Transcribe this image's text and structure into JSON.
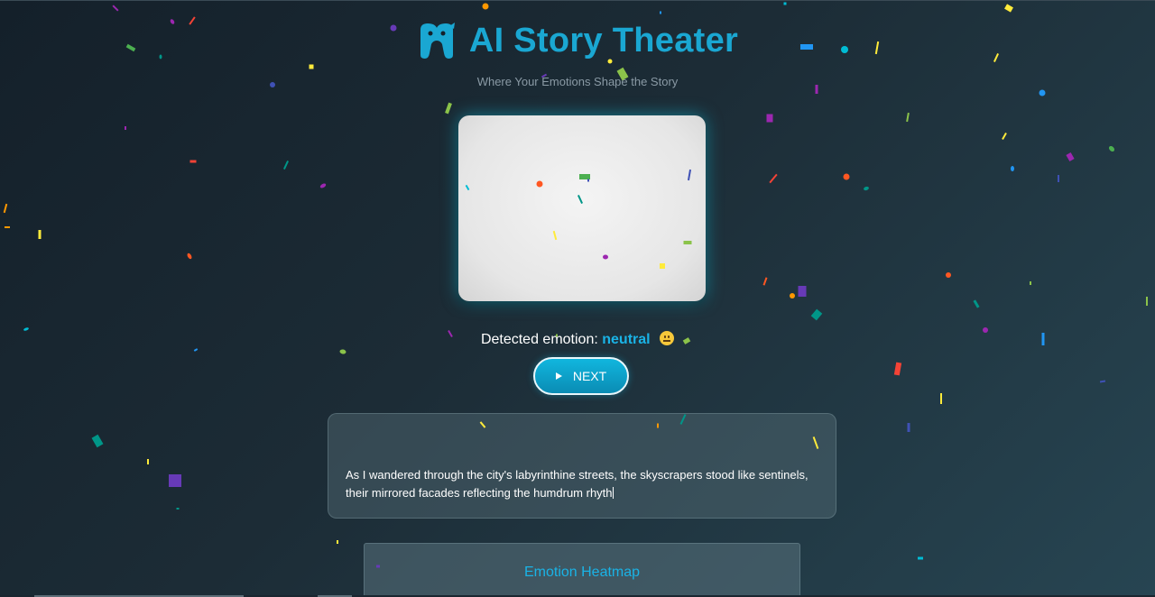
{
  "header": {
    "title": "AI Story Theater",
    "tagline": "Where Your Emotions Shape the Story",
    "logo_icon": "tooth-mascot-icon"
  },
  "webcam": {
    "label": "webcam-preview"
  },
  "emotion": {
    "prefix": "Detected emotion:",
    "value": "neutral",
    "emoji_icon": "neutral-face-icon"
  },
  "controls": {
    "next_label": "NEXT",
    "next_icon": "play-icon"
  },
  "story": {
    "text": "As I wandered through the city's labyrinthine streets, the skyscrapers stood like sentinels, their mirrored facades reflecting the humdrum rhyth"
  },
  "heatmap": {
    "title": "Emotion Heatmap"
  },
  "colors": {
    "accent": "#1aa7d2",
    "emotion_value": "#1ab3e6",
    "background_dark": "#14202a",
    "background_light": "#274552",
    "confetti": [
      "#ff5722",
      "#ffeb3b",
      "#4caf50",
      "#2196f3",
      "#9c27b0",
      "#673ab7",
      "#00bcd4",
      "#f44336",
      "#8bc34a",
      "#3f51b5",
      "#ff9800",
      "#009688"
    ]
  }
}
